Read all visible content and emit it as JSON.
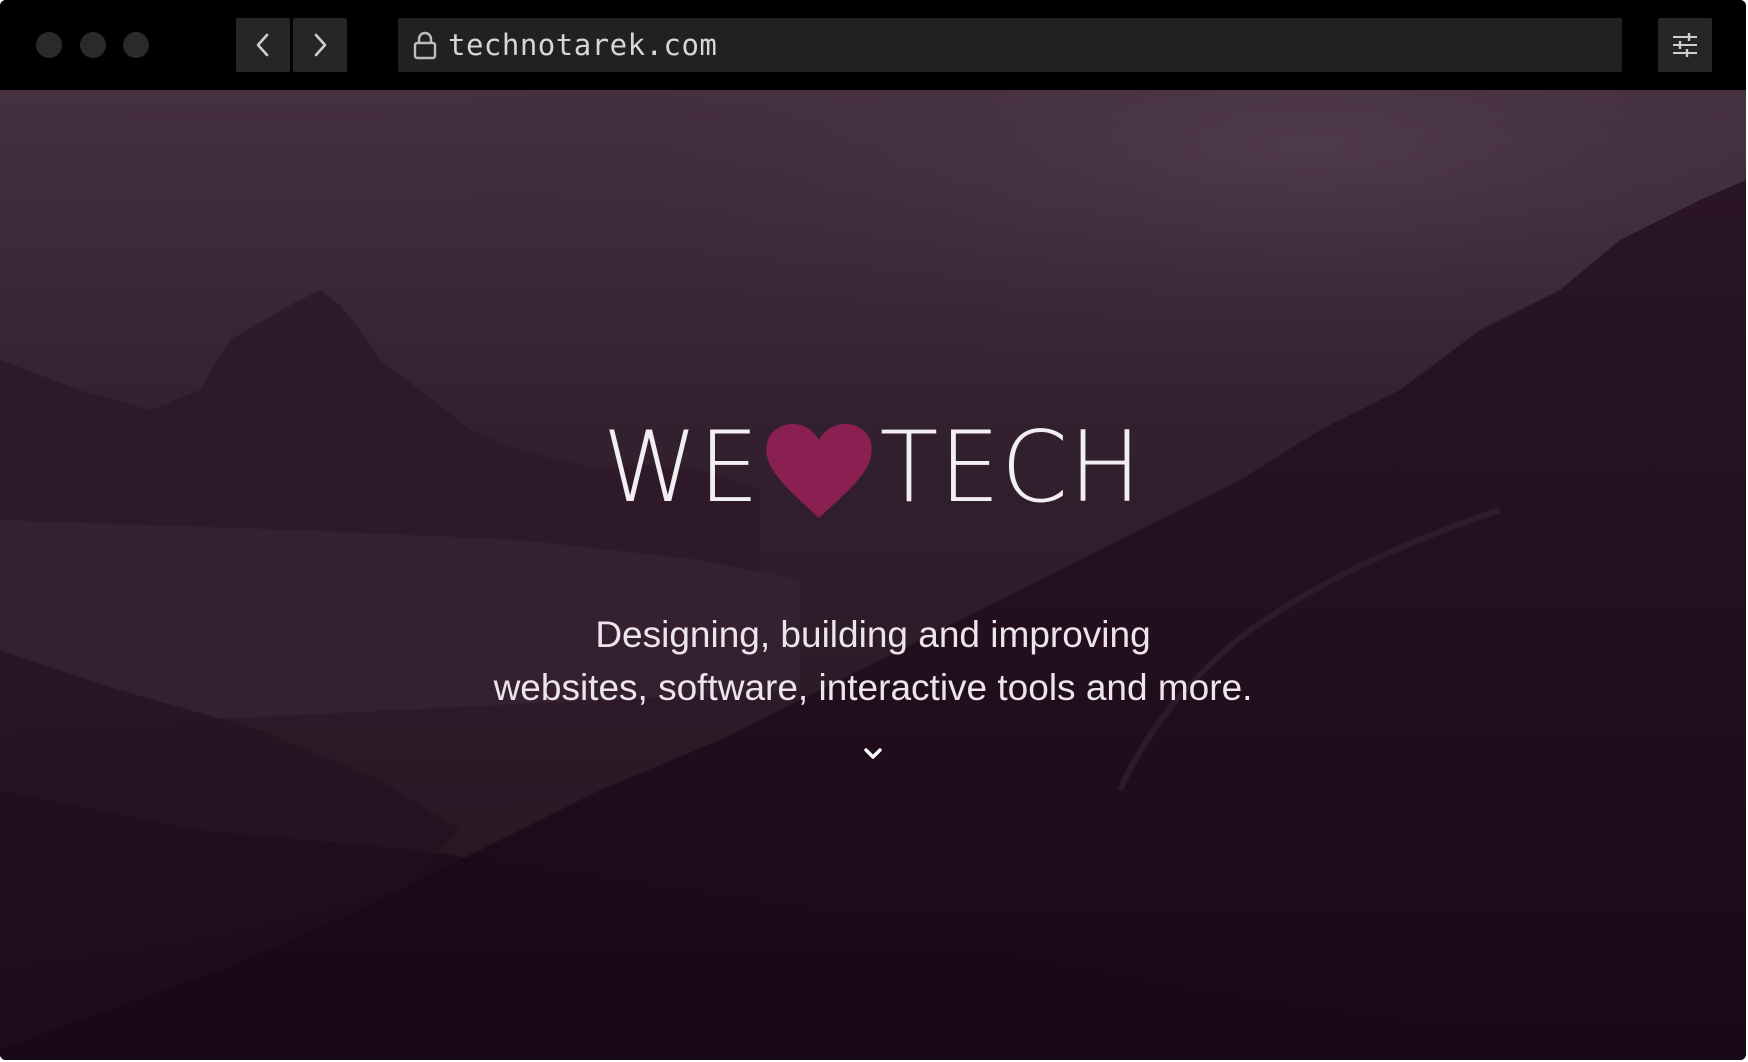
{
  "browser": {
    "url": "technotarek.com",
    "icons": {
      "back": "chevron-left-icon",
      "forward": "chevron-right-icon",
      "lock": "lock-icon",
      "settings": "sliders-icon"
    }
  },
  "hero": {
    "headline_left": "WE",
    "headline_right": "TECH",
    "heart_icon": "heart-icon",
    "tagline_line1": "Designing, building and improving",
    "tagline_line2": "websites, software, interactive tools and more.",
    "scroll_icon": "chevron-down-icon"
  },
  "colors": {
    "heart": "#8a1f52",
    "overlay": "#2a1327",
    "chrome": "#000000"
  }
}
